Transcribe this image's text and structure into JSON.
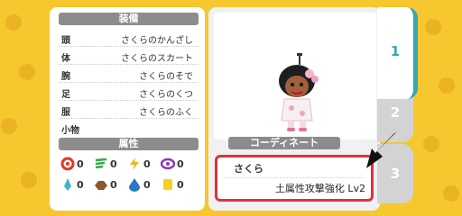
{
  "equipment": {
    "header": "装備",
    "slots": [
      {
        "slot": "頭",
        "item": "さくらのかんざし"
      },
      {
        "slot": "体",
        "item": "さくらのスカート"
      },
      {
        "slot": "腕",
        "item": "さくらのそで"
      },
      {
        "slot": "足",
        "item": "さくらのくつ"
      },
      {
        "slot": "服",
        "item": "さくらのふく"
      },
      {
        "slot": "小物",
        "item": ""
      }
    ]
  },
  "attributes": {
    "header": "属性",
    "row1": [
      {
        "icon": "fire-icon",
        "value": "0"
      },
      {
        "icon": "wind-icon",
        "value": "0"
      },
      {
        "icon": "lightning-icon",
        "value": "0"
      },
      {
        "icon": "dark-swirl-icon",
        "value": "0"
      }
    ],
    "row2": [
      {
        "icon": "ice-crystal-icon",
        "value": "0"
      },
      {
        "icon": "earth-icon",
        "value": "0"
      },
      {
        "icon": "water-drop-icon",
        "value": "0"
      },
      {
        "icon": "light-icon",
        "value": "0"
      }
    ]
  },
  "coordinate": {
    "header": "コーディネート",
    "name": "さくら",
    "effect": "土属性攻撃強化 Lv2"
  },
  "tabs": [
    {
      "label": "1",
      "active": true
    },
    {
      "label": "2",
      "active": false
    },
    {
      "label": "3",
      "active": false
    }
  ],
  "colors": {
    "background": "#f6c72f",
    "tab_accent": "#35a7b4",
    "highlight_border": "#e1313a",
    "header_gray": "#8c8c8c"
  }
}
